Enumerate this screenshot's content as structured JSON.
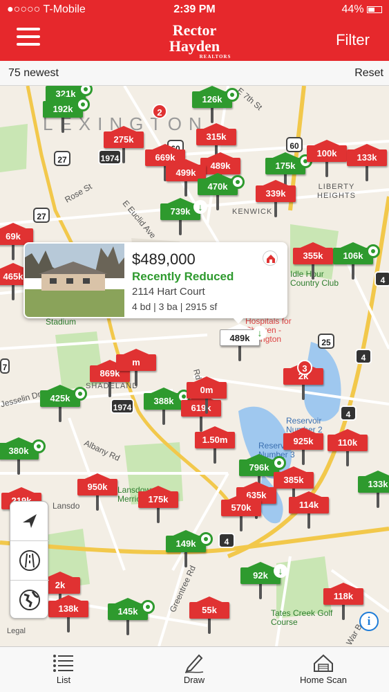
{
  "status_bar": {
    "carrier": "●○○○○ T-Mobile",
    "time": "2:39 PM",
    "battery": "44%"
  },
  "header": {
    "logo_line1": "Rector",
    "logo_line2": "Hayden",
    "logo_line3": "REALTORS",
    "filter_label": "Filter",
    "menu_icon": "hamburger-menu-icon"
  },
  "subbar": {
    "count_label": "75 newest",
    "reset_label": "Reset"
  },
  "map": {
    "labels": {
      "lexington": "LEXINGTON",
      "rose_st": "Rose St",
      "euclid": "E Euclid Ave",
      "kenwick": "KENWICK",
      "liberty": "LIBERTY HEIGHTS",
      "seventh": "E 7th St",
      "stadium": "Stadium",
      "hospitals": "Hospitals for Children - Lexington",
      "shadeland": "SHADELAND",
      "jesselin": "Jesselin Dr",
      "albany": "Albany Rd",
      "lansdowne": "Lansdowne Merrick Park",
      "reservoir2": "Reservoir Number 2",
      "reservoir3": "Reservoir Number 3",
      "idle_hour": "Idle Hour Country Club",
      "greentree": "Greentree Rd",
      "tates": "Tates Creek Golf Course",
      "war": "War B",
      "lansdo": "Lansdo",
      "rd": "Rd"
    },
    "shields": [
      "27",
      "1974",
      "60",
      "27",
      "60",
      "4",
      "25",
      "4",
      "4",
      "1974",
      "4",
      "7"
    ],
    "pins": [
      {
        "label": "321k",
        "color": "green",
        "marker": "dot"
      },
      {
        "label": "192k",
        "color": "green",
        "marker": "dot"
      },
      {
        "label": "126k",
        "color": "green",
        "marker": "dot"
      },
      {
        "label": "275k",
        "color": "red",
        "marker": ""
      },
      {
        "label": "315k",
        "color": "red",
        "marker": ""
      },
      {
        "label": "669k",
        "color": "red",
        "marker": ""
      },
      {
        "label": "489k",
        "color": "red",
        "marker": ""
      },
      {
        "label": "499k",
        "color": "red",
        "marker": ""
      },
      {
        "label": "470k",
        "color": "green",
        "marker": "dot"
      },
      {
        "label": "175k",
        "color": "green",
        "marker": "dot"
      },
      {
        "label": "100k",
        "color": "red",
        "marker": ""
      },
      {
        "label": "133k",
        "color": "red",
        "marker": ""
      },
      {
        "label": "339k",
        "color": "red",
        "marker": ""
      },
      {
        "label": "739k",
        "color": "green",
        "marker": "arrow"
      },
      {
        "label": "69k",
        "color": "red",
        "marker": ""
      },
      {
        "label": "465k",
        "color": "red",
        "marker": ""
      },
      {
        "label": "355k",
        "color": "red",
        "marker": ""
      },
      {
        "label": "106k",
        "color": "green",
        "marker": "dot"
      },
      {
        "label": "489k",
        "color": "white",
        "marker": "arrow"
      },
      {
        "label": "869k",
        "color": "red",
        "marker": ""
      },
      {
        "label": "425k",
        "color": "green",
        "marker": "dot"
      },
      {
        "label": "388k",
        "color": "green",
        "marker": "dot"
      },
      {
        "label": "619k",
        "color": "red",
        "marker": ""
      },
      {
        "label": "1.50m",
        "color": "red",
        "marker": ""
      },
      {
        "label": "380k",
        "color": "green",
        "marker": "dot"
      },
      {
        "label": "925k",
        "color": "red",
        "marker": ""
      },
      {
        "label": "110k",
        "color": "red",
        "marker": ""
      },
      {
        "label": "796k",
        "color": "green",
        "marker": "dot"
      },
      {
        "label": "385k",
        "color": "red",
        "marker": ""
      },
      {
        "label": "950k",
        "color": "red",
        "marker": ""
      },
      {
        "label": "219k",
        "color": "red",
        "marker": ""
      },
      {
        "label": "175k",
        "color": "red",
        "marker": ""
      },
      {
        "label": "635k",
        "color": "red",
        "marker": ""
      },
      {
        "label": "570k",
        "color": "red",
        "marker": ""
      },
      {
        "label": "114k",
        "color": "red",
        "marker": ""
      },
      {
        "label": "133k",
        "color": "green",
        "marker": ""
      },
      {
        "label": "149k",
        "color": "green",
        "marker": "dot"
      },
      {
        "label": "92k",
        "color": "green",
        "marker": "arrow"
      },
      {
        "label": "2k",
        "color": "red",
        "marker": ""
      },
      {
        "label": "138k",
        "color": "red",
        "marker": ""
      },
      {
        "label": "145k",
        "color": "green",
        "marker": "dot"
      },
      {
        "label": "55k",
        "color": "red",
        "marker": ""
      },
      {
        "label": "118k",
        "color": "red",
        "marker": ""
      },
      {
        "label": "2k",
        "color": "red",
        "marker": ""
      },
      {
        "label": "0m",
        "color": "red",
        "marker": ""
      },
      {
        "label": "m",
        "color": "red",
        "marker": ""
      }
    ],
    "clusters": [
      "2",
      "3"
    ],
    "legal": "Legal",
    "info_icon": "info-icon"
  },
  "callout": {
    "price": "$489,000",
    "status": "Recently Reduced",
    "address": "2114 Hart Court",
    "specs": "4 bd | 3 ba | 2915 sf",
    "icon": "home-icon"
  },
  "controls": [
    "location-arrow-icon",
    "road-view-icon",
    "globe-icon"
  ],
  "tabbar": {
    "list_label": "List",
    "draw_label": "Draw",
    "home_scan_label": "Home Scan"
  }
}
